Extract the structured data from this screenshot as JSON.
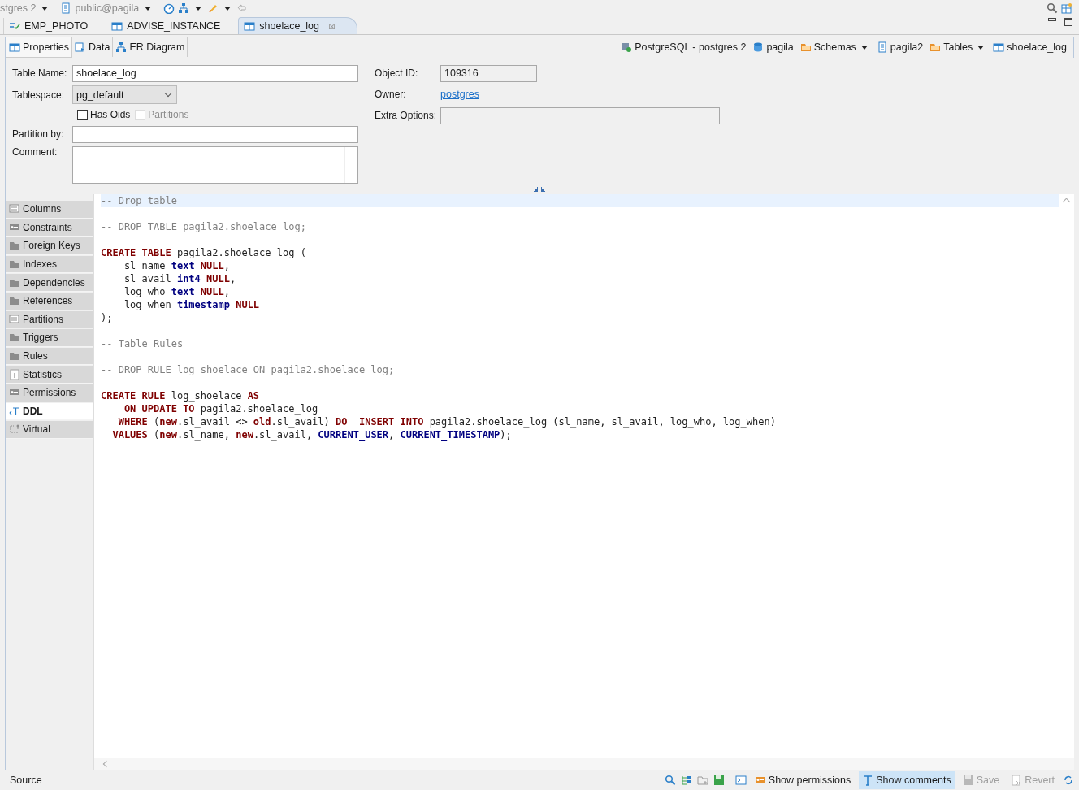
{
  "toolbar": {
    "connection": "stgres 2",
    "database": "public@pagila"
  },
  "editor_tabs": [
    {
      "label": "EMP_PHOTO",
      "selected": false
    },
    {
      "label": "ADVISE_INSTANCE",
      "selected": false
    },
    {
      "label": "shoelace_log",
      "selected": true,
      "close": "⊠"
    }
  ],
  "sub_tabs": [
    {
      "label": "Properties",
      "selected": true
    },
    {
      "label": "Data",
      "selected": false
    },
    {
      "label": "ER Diagram",
      "selected": false
    }
  ],
  "breadcrumb": [
    {
      "label": "PostgreSQL - postgres 2",
      "dropdown": false
    },
    {
      "label": "pagila",
      "dropdown": false
    },
    {
      "label": "Schemas",
      "dropdown": true
    },
    {
      "label": "pagila2",
      "dropdown": false
    },
    {
      "label": "Tables",
      "dropdown": true
    },
    {
      "label": "shoelace_log",
      "dropdown": false
    }
  ],
  "properties": {
    "table_name": {
      "label": "Table Name:",
      "value": "shoelace_log"
    },
    "tablespace": {
      "label": "Tablespace:",
      "value": "pg_default"
    },
    "checkboxes": [
      {
        "label": "Has Oids",
        "checked": false,
        "disabled": false
      },
      {
        "label": "Partitions",
        "checked": false,
        "disabled": true
      }
    ],
    "partition_by": {
      "label": "Partition by:"
    },
    "comment": {
      "label": "Comment:"
    },
    "object_id": {
      "label": "Object ID:",
      "value": "109316"
    },
    "owner": {
      "label": "Owner:",
      "value": "postgres"
    },
    "extra_options": {
      "label": "Extra Options:"
    }
  },
  "side_tabs": [
    {
      "label": "Columns",
      "selected": false
    },
    {
      "label": "Constraints",
      "selected": false
    },
    {
      "label": "Foreign Keys",
      "selected": false
    },
    {
      "label": "Indexes",
      "selected": false
    },
    {
      "label": "Dependencies",
      "selected": false
    },
    {
      "label": "References",
      "selected": false
    },
    {
      "label": "Partitions",
      "selected": false
    },
    {
      "label": "Triggers",
      "selected": false
    },
    {
      "label": "Rules",
      "selected": false
    },
    {
      "label": "Statistics",
      "selected": false
    },
    {
      "label": "Permissions",
      "selected": false
    },
    {
      "label": "DDL",
      "selected": true
    },
    {
      "label": "Virtual",
      "selected": false
    }
  ],
  "code_blocks": [
    {
      "lines": [
        {
          "current": true,
          "tokens": [
            {
              "kind": "comment",
              "text": "-- Drop table"
            }
          ]
        }
      ]
    },
    {
      "lines": [
        {
          "current": false,
          "tokens": [
            {
              "kind": "comment",
              "text": "-- DROP TABLE pagila2.shoelace_log;"
            }
          ]
        }
      ]
    },
    {
      "lines": [
        {
          "current": false,
          "tokens": [
            {
              "kind": "keyword",
              "text": "CREATE TABLE"
            },
            {
              "kind": "plain",
              "text": " pagila2.shoelace_log ("
            }
          ]
        },
        {
          "current": false,
          "tokens": [
            {
              "kind": "plain",
              "text": "    sl_name "
            },
            {
              "kind": "type",
              "text": "text"
            },
            {
              "kind": "keyword",
              "text": " NULL"
            },
            {
              "kind": "plain",
              "text": ","
            }
          ]
        },
        {
          "current": false,
          "tokens": [
            {
              "kind": "plain",
              "text": "    sl_avail "
            },
            {
              "kind": "type",
              "text": "int4"
            },
            {
              "kind": "keyword",
              "text": " NULL"
            },
            {
              "kind": "plain",
              "text": ","
            }
          ]
        },
        {
          "current": false,
          "tokens": [
            {
              "kind": "plain",
              "text": "    log_who "
            },
            {
              "kind": "type",
              "text": "text"
            },
            {
              "kind": "keyword",
              "text": " NULL"
            },
            {
              "kind": "plain",
              "text": ","
            }
          ]
        },
        {
          "current": false,
          "tokens": [
            {
              "kind": "plain",
              "text": "    log_when "
            },
            {
              "kind": "type",
              "text": "timestamp"
            },
            {
              "kind": "keyword",
              "text": " NULL"
            }
          ]
        },
        {
          "current": false,
          "tokens": [
            {
              "kind": "plain",
              "text": ");"
            }
          ]
        }
      ]
    },
    {
      "lines": [
        {
          "current": false,
          "tokens": [
            {
              "kind": "comment",
              "text": "-- Table Rules"
            }
          ]
        }
      ]
    },
    {
      "lines": [
        {
          "current": false,
          "tokens": [
            {
              "kind": "comment",
              "text": "-- DROP RULE log_shoelace ON pagila2.shoelace_log;"
            }
          ]
        }
      ]
    },
    {
      "lines": [
        {
          "current": false,
          "tokens": [
            {
              "kind": "keyword",
              "text": "CREATE RULE"
            },
            {
              "kind": "plain",
              "text": " log_shoelace "
            },
            {
              "kind": "keyword",
              "text": "AS"
            }
          ]
        },
        {
          "current": false,
          "tokens": [
            {
              "kind": "keyword",
              "text": "    ON UPDATE TO"
            },
            {
              "kind": "plain",
              "text": " pagila2.shoelace_log"
            }
          ]
        },
        {
          "current": false,
          "tokens": [
            {
              "kind": "keyword",
              "text": "   WHERE"
            },
            {
              "kind": "plain",
              "text": " ("
            },
            {
              "kind": "keyword",
              "text": "new"
            },
            {
              "kind": "plain",
              "text": ".sl_avail <> "
            },
            {
              "kind": "keyword",
              "text": "old"
            },
            {
              "kind": "plain",
              "text": ".sl_avail) "
            },
            {
              "kind": "keyword",
              "text": "DO  INSERT INTO"
            },
            {
              "kind": "plain",
              "text": " pagila2.shoelace_log (sl_name, sl_avail, log_who, log_when)"
            }
          ]
        },
        {
          "current": false,
          "tokens": [
            {
              "kind": "keyword",
              "text": "  VALUES"
            },
            {
              "kind": "plain",
              "text": " ("
            },
            {
              "kind": "keyword",
              "text": "new"
            },
            {
              "kind": "plain",
              "text": ".sl_name, "
            },
            {
              "kind": "keyword",
              "text": "new"
            },
            {
              "kind": "plain",
              "text": ".sl_avail, "
            },
            {
              "kind": "type",
              "text": "CURRENT_USER"
            },
            {
              "kind": "plain",
              "text": ", "
            },
            {
              "kind": "type",
              "text": "CURRENT_TIMESTAMP"
            },
            {
              "kind": "plain",
              "text": ");"
            }
          ]
        }
      ]
    }
  ],
  "status_bar": {
    "label": "Source",
    "buttons": [
      {
        "label": "Show permissions",
        "on": false,
        "disabled": false
      },
      {
        "label": "Show comments",
        "on": true,
        "disabled": false
      },
      {
        "label": "Save",
        "on": false,
        "disabled": true
      },
      {
        "label": "Revert",
        "on": false,
        "disabled": true
      }
    ]
  }
}
